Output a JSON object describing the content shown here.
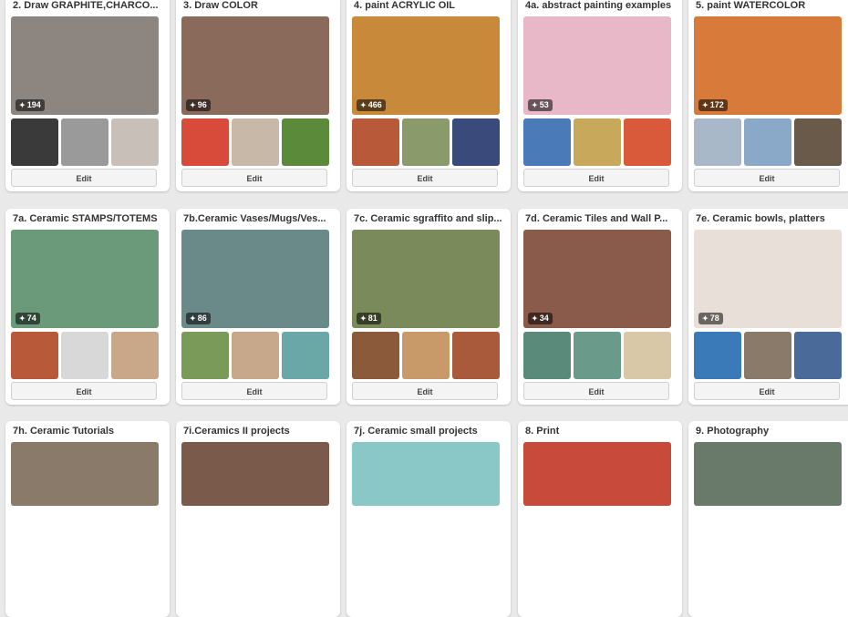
{
  "edit_label": "Edit",
  "pin_icon": "pin-icon",
  "boards": [
    {
      "title": "2. Draw GRAPHITE,CHARCO...",
      "count": "194",
      "cover": "#8c8580",
      "thumbs": [
        "#3a3a3a",
        "#9a9a9a",
        "#c8c0b8"
      ]
    },
    {
      "title": "3. Draw COLOR",
      "count": "96",
      "cover": "#8a6a5a",
      "thumbs": [
        "#d84a3a",
        "#c8b8a8",
        "#5a8a3a"
      ]
    },
    {
      "title": "4. paint ACRYLIC OIL",
      "count": "466",
      "cover": "#c88a3a",
      "thumbs": [
        "#b85a3a",
        "#8a9a6a",
        "#3a4a7a"
      ]
    },
    {
      "title": "4a. abstract painting examples",
      "count": "53",
      "cover": "#e8b8c8",
      "thumbs": [
        "#4a7ab8",
        "#c8a85a",
        "#d85a3a"
      ]
    },
    {
      "title": "5. paint WATERCOLOR",
      "count": "172",
      "cover": "#d87a3a",
      "thumbs": [
        "#a8b8c8",
        "#8aa8c8",
        "#6a5a4a"
      ]
    },
    {
      "title": "7a. Ceramic STAMPS/TOTEMS",
      "count": "74",
      "cover": "#6a9a7a",
      "thumbs": [
        "#b85a3a",
        "#d8d8d8",
        "#c8a888"
      ]
    },
    {
      "title": "7b.Ceramic Vases/Mugs/Ves...",
      "count": "86",
      "cover": "#6a8a8a",
      "thumbs": [
        "#7a9a5a",
        "#c8a88a",
        "#6aa8a8"
      ]
    },
    {
      "title": "7c. Ceramic sgraffito and slip...",
      "count": "81",
      "cover": "#7a8a5a",
      "thumbs": [
        "#8a5a3a",
        "#c89a6a",
        "#a85a3a"
      ]
    },
    {
      "title": "7d. Ceramic Tiles and Wall P...",
      "count": "34",
      "cover": "#8a5a4a",
      "thumbs": [
        "#5a8a7a",
        "#6a9a8a",
        "#d8c8a8"
      ]
    },
    {
      "title": "7e. Ceramic bowls, platters",
      "count": "78",
      "cover": "#e8e0d8",
      "thumbs": [
        "#3a7ab8",
        "#8a7a6a",
        "#4a6a9a"
      ]
    },
    {
      "title": "7h. Ceramic Tutorials",
      "count": "",
      "cover": "#8a7a6a",
      "thumbs": []
    },
    {
      "title": "7i.Ceramics II projects",
      "count": "",
      "cover": "#7a5a4a",
      "thumbs": []
    },
    {
      "title": "7j. Ceramic small projects",
      "count": "",
      "cover": "#8ac8c8",
      "thumbs": []
    },
    {
      "title": "8. Print",
      "count": "",
      "cover": "#c84a3a",
      "thumbs": []
    },
    {
      "title": "9. Photography",
      "count": "",
      "cover": "#6a7a6a",
      "thumbs": []
    }
  ]
}
